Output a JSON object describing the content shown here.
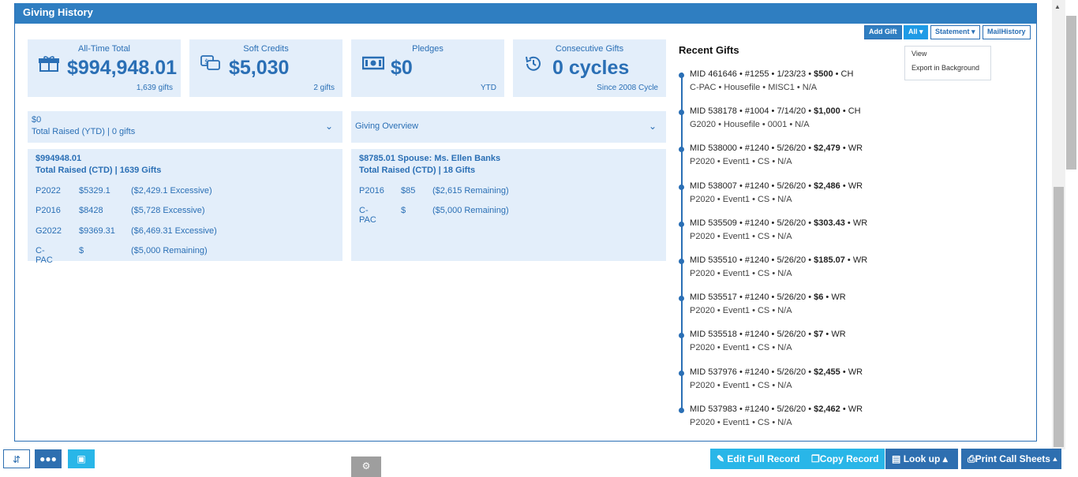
{
  "header": {
    "title": "Giving History"
  },
  "cards": [
    {
      "title": "All-Time Total",
      "value": "$994,948.01",
      "sub": "1,639 gifts",
      "icon": "gift-icon"
    },
    {
      "title": "Soft Credits",
      "value": "$5,030",
      "sub": "2 gifts",
      "icon": "speech-dollar-icon"
    },
    {
      "title": "Pledges",
      "value": "$0",
      "sub": "YTD",
      "icon": "cash-icon"
    },
    {
      "title": "Consecutive Gifts",
      "value": "0 cycles",
      "sub": "Since 2008 Cycle",
      "icon": "history-icon"
    }
  ],
  "bar_left": {
    "amount": "$0",
    "label": "Total Raised (YTD) | 0 gifts"
  },
  "bar_right": {
    "label": "Giving Overview"
  },
  "detail_left": {
    "amount": "$994948.01",
    "label": "Total Raised (CTD) | 1639 Gifts",
    "rows": [
      {
        "code": "P2022",
        "amount": "$5329.1",
        "note": "($2,429.1 Excessive)"
      },
      {
        "code": "P2016",
        "amount": "$8428",
        "note": "($5,728 Excessive)"
      },
      {
        "code": "G2022",
        "amount": "$9369.31",
        "note": "($6,469.31 Excessive)"
      },
      {
        "code": "C-PAC",
        "amount": "$",
        "note": "($5,000 Remaining)"
      }
    ]
  },
  "detail_right": {
    "amount": "$8785.01 Spouse: Ms. Ellen Banks",
    "label": "Total Raised (CTD) | 18 Gifts",
    "rows": [
      {
        "code": "P2016",
        "amount": "$85",
        "note": "($2,615 Remaining)"
      },
      {
        "code": "C-PAC",
        "amount": "$",
        "note": "($5,000 Remaining)"
      }
    ]
  },
  "toolbar": {
    "add_gift": "Add Gift",
    "all": "All",
    "statement": "Statement",
    "mail_history": "MailHistory"
  },
  "dropdown": {
    "view": "View",
    "export": "Export in Background"
  },
  "recent": {
    "title": "Recent Gifts",
    "gifts": [
      {
        "pre": "MID 461646 • #1255 • 1/23/23 • ",
        "amount": "$500",
        "post": " • CH",
        "line2": "C-PAC • Housefile • MISC1 • N/A"
      },
      {
        "pre": "MID 538178 • #1004 • 7/14/20 • ",
        "amount": "$1,000",
        "post": " • CH",
        "line2": "G2020 • Housefile • 0001 • N/A"
      },
      {
        "pre": "MID 538000 • #1240 • 5/26/20 • ",
        "amount": "$2,479",
        "post": " • WR",
        "line2": "P2020 • Event1 • CS • N/A"
      },
      {
        "pre": "MID 538007 • #1240 • 5/26/20 • ",
        "amount": "$2,486",
        "post": " • WR",
        "line2": "P2020 • Event1 • CS • N/A"
      },
      {
        "pre": "MID 535509 • #1240 • 5/26/20 • ",
        "amount": "$303.43",
        "post": " • WR",
        "line2": "P2020 • Event1 • CS • N/A"
      },
      {
        "pre": "MID 535510 • #1240 • 5/26/20 • ",
        "amount": "$185.07",
        "post": " • WR",
        "line2": "P2020 • Event1 • CS • N/A"
      },
      {
        "pre": "MID 535517 • #1240 • 5/26/20 • ",
        "amount": "$6",
        "post": " • WR",
        "line2": "P2020 • Event1 • CS • N/A"
      },
      {
        "pre": "MID 535518 • #1240 • 5/26/20 • ",
        "amount": "$7",
        "post": " • WR",
        "line2": "P2020 • Event1 • CS • N/A"
      },
      {
        "pre": "MID 537976 • #1240 • 5/26/20 • ",
        "amount": "$2,455",
        "post": " • WR",
        "line2": "P2020 • Event1 • CS • N/A"
      },
      {
        "pre": "MID 537983 • #1240 • 5/26/20 • ",
        "amount": "$2,462",
        "post": " • WR",
        "line2": "P2020 • Event1 • CS • N/A"
      }
    ]
  },
  "bottom": {
    "edit_full_record": "Edit Full Record",
    "copy_record": "Copy Record",
    "look_up": "Look up",
    "print_call_sheets": "Print Call Sheets"
  },
  "colors": {
    "accent": "#2f7ec1",
    "card_bg": "#e3eefa",
    "cyan": "#29b6e8",
    "navy": "#2e6fb0"
  }
}
